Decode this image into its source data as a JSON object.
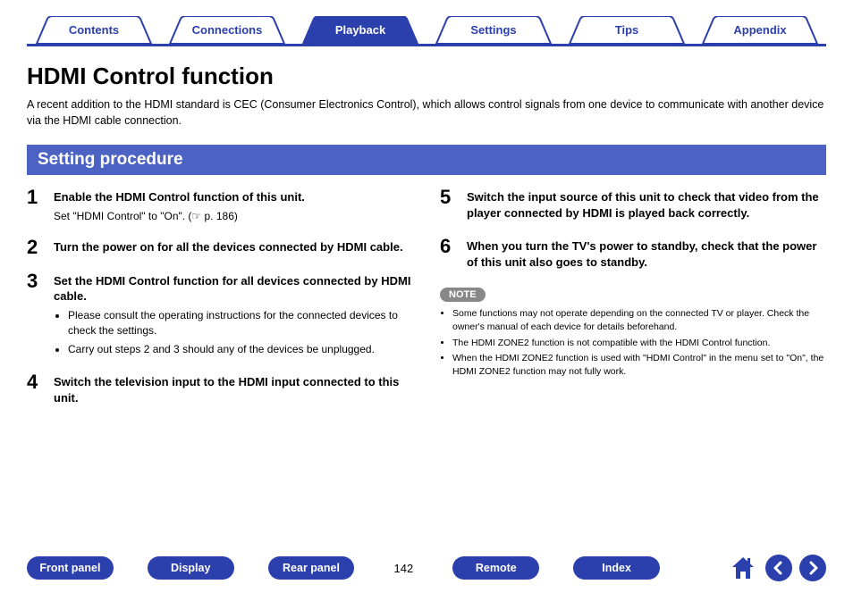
{
  "tabs": [
    {
      "label": "Contents",
      "active": false
    },
    {
      "label": "Connections",
      "active": false
    },
    {
      "label": "Playback",
      "active": true
    },
    {
      "label": "Settings",
      "active": false
    },
    {
      "label": "Tips",
      "active": false
    },
    {
      "label": "Appendix",
      "active": false
    }
  ],
  "title": "HDMI Control function",
  "intro": "A recent addition to the HDMI standard is CEC (Consumer Electronics Control), which allows control signals from one device to communicate with another device via the HDMI cable connection.",
  "subheading": "Setting procedure",
  "steps_left": [
    {
      "num": "1",
      "title": "Enable the HDMI Control function of this unit.",
      "sub": "Set \"HDMI Control\" to \"On\".  (☞ p. 186)",
      "bullets": []
    },
    {
      "num": "2",
      "title": "Turn the power on for all the devices connected by HDMI cable.",
      "sub": "",
      "bullets": []
    },
    {
      "num": "3",
      "title": "Set the HDMI Control function for all devices connected by HDMI cable.",
      "sub": "",
      "bullets": [
        "Please consult the operating instructions for the connected devices to check the settings.",
        "Carry out steps 2 and 3 should any of the devices be unplugged."
      ]
    },
    {
      "num": "4",
      "title": "Switch the television input to the HDMI input connected to this unit.",
      "sub": "",
      "bullets": []
    }
  ],
  "steps_right": [
    {
      "num": "5",
      "title": "Switch the input source of this unit to check that video from the player connected by HDMI is played back correctly.",
      "sub": "",
      "bullets": []
    },
    {
      "num": "6",
      "title": "When you turn the TV's power to standby, check that the power of this unit also goes to standby.",
      "sub": "",
      "bullets": []
    }
  ],
  "note_label": "NOTE",
  "note_items": [
    "Some functions may not operate depending on the connected TV or player. Check the owner's manual of each device for details beforehand.",
    "The HDMI ZONE2 function is not compatible with the HDMI Control function.",
    "When the HDMI ZONE2 function is used with \"HDMI Control\" in the menu set to \"On\", the HDMI ZONE2 function may not fully work."
  ],
  "footer": {
    "buttons": [
      "Front panel",
      "Display",
      "Rear panel"
    ],
    "page": "142",
    "buttons2": [
      "Remote",
      "Index"
    ]
  }
}
